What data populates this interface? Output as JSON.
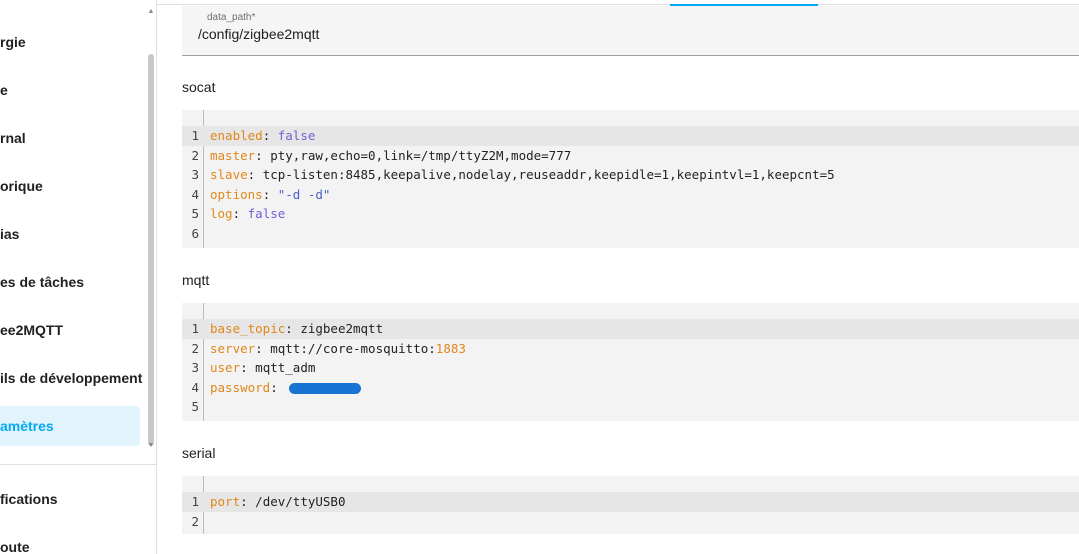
{
  "sidebar": {
    "items": [
      {
        "label": "rgie",
        "active": false
      },
      {
        "label": "e",
        "active": false
      },
      {
        "label": "rnal",
        "active": false
      },
      {
        "label": "orique",
        "active": false
      },
      {
        "label": "ias",
        "active": false
      },
      {
        "label": "es de tâches",
        "active": false
      },
      {
        "label": "ee2MQTT",
        "active": false
      },
      {
        "label": "ils de développement",
        "active": false
      },
      {
        "label": "amètres",
        "active": true
      }
    ],
    "bottom_items": [
      {
        "label": "fications"
      },
      {
        "label": "oute"
      }
    ]
  },
  "field": {
    "label": "data_path*",
    "value": "/config/zigbee2mqtt"
  },
  "sections": {
    "socat": {
      "title": "socat",
      "lines": [
        {
          "n": "1",
          "key": "enabled",
          "sep": ": ",
          "value": "false",
          "vtype": "vb"
        },
        {
          "n": "2",
          "key": "master",
          "sep": ": ",
          "value": "pty,raw,echo=0,link=/tmp/ttyZ2M,mode=777",
          "vtype": "v"
        },
        {
          "n": "3",
          "key": "slave",
          "sep": ": ",
          "value": "tcp-listen:8485,keepalive,nodelay,reuseaddr,keepidle=1,keepintvl=1,keepcnt=5",
          "vtype": "v"
        },
        {
          "n": "4",
          "key": "options",
          "sep": ": ",
          "value": "\"-d -d\"",
          "vtype": "vs"
        },
        {
          "n": "5",
          "key": "log",
          "sep": ": ",
          "value": "false",
          "vtype": "vb"
        },
        {
          "n": "6",
          "key": "",
          "sep": "",
          "value": "",
          "vtype": "v"
        }
      ]
    },
    "mqtt": {
      "title": "mqtt",
      "lines": [
        {
          "n": "1",
          "key": "base_topic",
          "sep": ": ",
          "value": "zigbee2mqtt",
          "vtype": "v"
        },
        {
          "n": "2",
          "key": "server",
          "sep": ": ",
          "value": "mqtt://core-mosquitto:",
          "vtype": "v",
          "extra": "1883"
        },
        {
          "n": "3",
          "key": "user",
          "sep": ": ",
          "value": "mqtt_adm",
          "vtype": "v"
        },
        {
          "n": "4",
          "key": "password",
          "sep": ": ",
          "value": "",
          "vtype": "v",
          "redacted": true
        },
        {
          "n": "5",
          "key": "",
          "sep": "",
          "value": "",
          "vtype": "v"
        }
      ]
    },
    "serial": {
      "title": "serial",
      "lines": [
        {
          "n": "1",
          "key": "port",
          "sep": ": ",
          "value": "/dev/ttyUSB0",
          "vtype": "v"
        },
        {
          "n": "2",
          "key": "",
          "sep": "",
          "value": "",
          "vtype": "v"
        }
      ]
    }
  },
  "colors": {
    "accent": "#03a9f4",
    "key": "#e0881a",
    "bool": "#6d62d7",
    "string": "#4a61c9",
    "redaction": "#1674d2"
  },
  "icons": {
    "scroll_up": "chevron-up-icon",
    "scroll_down": "chevron-down-icon"
  }
}
